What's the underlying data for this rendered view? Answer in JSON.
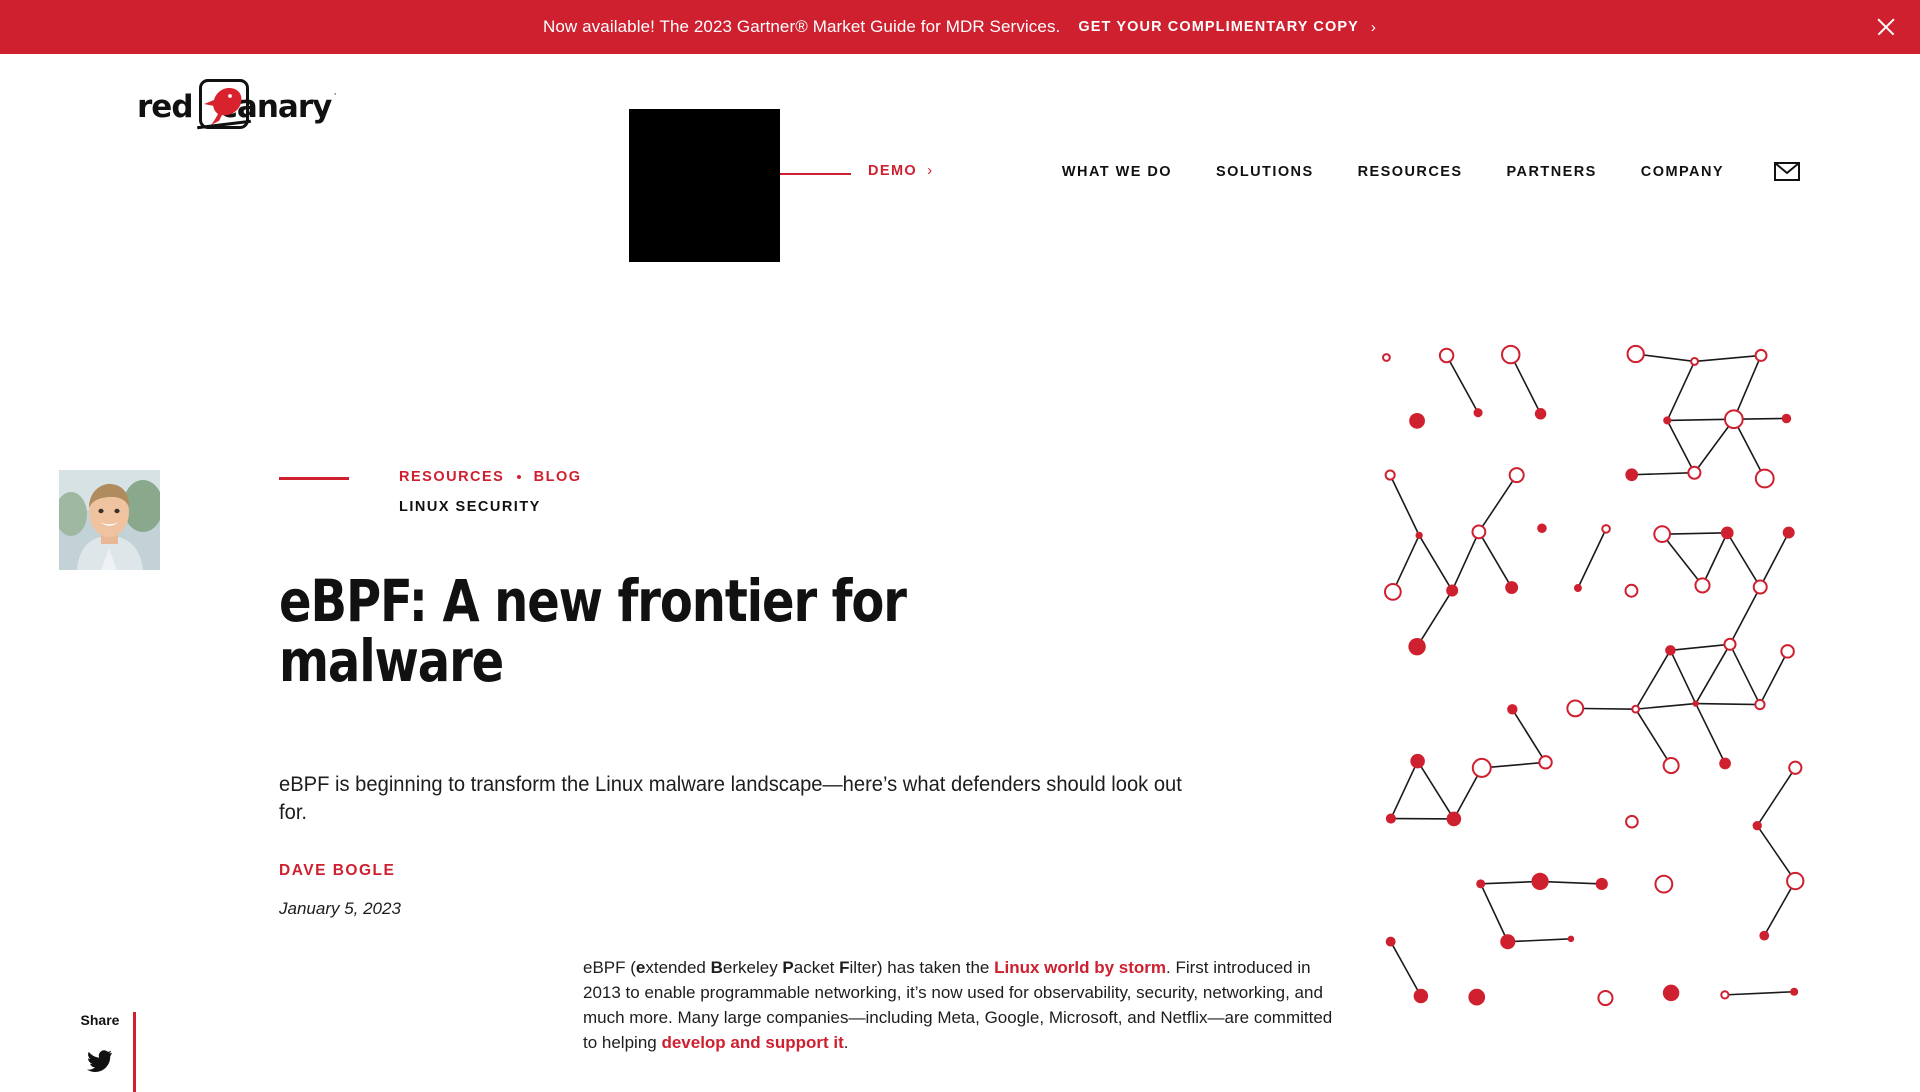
{
  "banner": {
    "message": "Now available! The 2023 Gartner® Market Guide for MDR Services.",
    "cta_label": "GET YOUR COMPLIMENTARY COPY",
    "cta_chevron": "›",
    "close_icon": "close-icon",
    "background_color": "#cf2030",
    "text_color": "#ffffff"
  },
  "header": {
    "logo": {
      "word_one": "red",
      "word_two": "canary",
      "registered": "·",
      "mark_icon": "canary-bird-icon"
    },
    "demo": {
      "label": "DEMO",
      "chevron": "›"
    },
    "nav_items": [
      {
        "label": "WHAT WE DO"
      },
      {
        "label": "SOLUTIONS"
      },
      {
        "label": "RESOURCES"
      },
      {
        "label": "PARTNERS"
      },
      {
        "label": "COMPANY"
      }
    ],
    "mail_icon": "envelope-icon"
  },
  "hero": {
    "avatar_icon": "author-headshot",
    "breadcrumb": {
      "items": [
        {
          "label": "RESOURCES"
        },
        {
          "label": "BLOG"
        }
      ],
      "separator": "•"
    },
    "category": "LINUX SECURITY",
    "title": "eBPF: A new frontier for malware",
    "dek": "eBPF is beginning to transform the Linux malware landscape—here’s what defenders should look out for.",
    "author": "DAVE BOGLE",
    "date": "January 5, 2023",
    "decoration_icon": "network-lattice-graphic"
  },
  "article": {
    "paragraph_parts": [
      {
        "type": "text",
        "value": "eBPF ("
      },
      {
        "type": "bold",
        "value": "e"
      },
      {
        "type": "text",
        "value": "xtended "
      },
      {
        "type": "bold",
        "value": "B"
      },
      {
        "type": "text",
        "value": "erkeley "
      },
      {
        "type": "bold",
        "value": "P"
      },
      {
        "type": "text",
        "value": "acket "
      },
      {
        "type": "bold",
        "value": "F"
      },
      {
        "type": "text",
        "value": "ilter) has taken the "
      },
      {
        "type": "link",
        "value": "Linux world by storm"
      },
      {
        "type": "text",
        "value": ". First introduced in 2013 to enable programmable networking, it’s now used for observability, security, networking, and much more. Many large companies—including Meta, Google, Microsoft, and Netflix—are committed to helping "
      },
      {
        "type": "link",
        "value": "develop and support it"
      },
      {
        "type": "text",
        "value": "."
      }
    ]
  },
  "share": {
    "label": "Share",
    "icons": [
      {
        "name": "twitter-x-icon"
      }
    ]
  },
  "colors": {
    "brand_red": "#cf2030",
    "ink": "#111111",
    "body": "#1d1d1d"
  }
}
